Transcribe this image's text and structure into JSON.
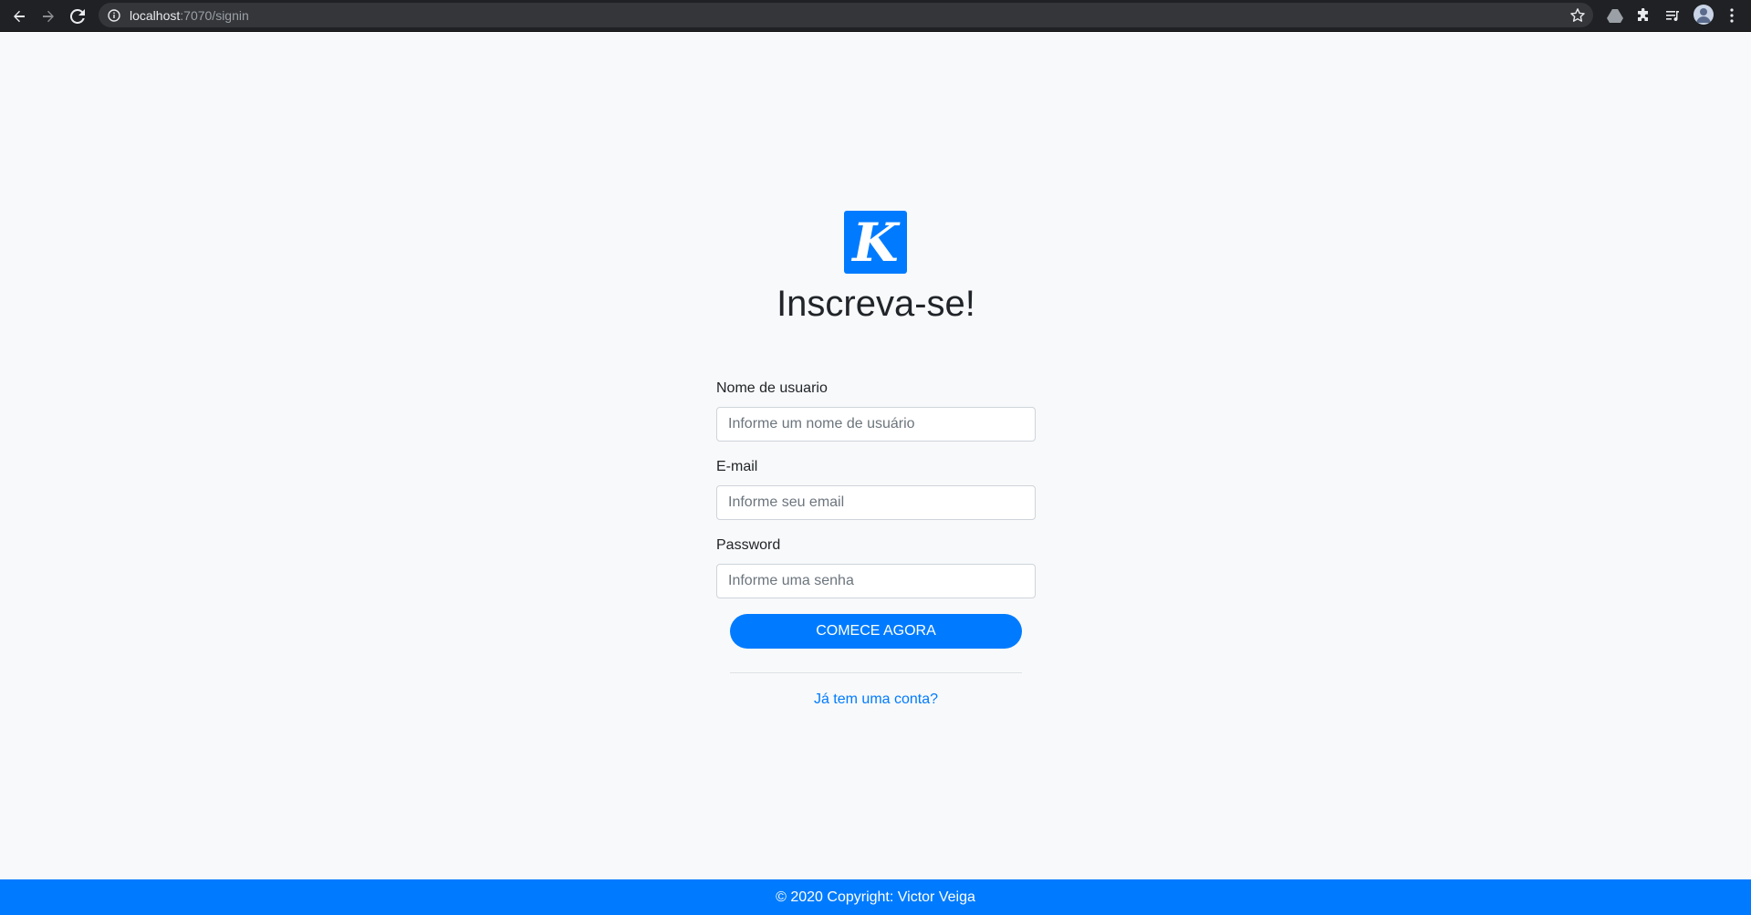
{
  "browser": {
    "url_host": "localhost",
    "url_path": ":7070/signin",
    "icons": {
      "back": "back-arrow-icon",
      "forward": "forward-arrow-icon",
      "reload": "reload-icon",
      "info": "info-icon",
      "star": "star-icon",
      "drive": "drive-icon",
      "extensions": "puzzle-icon",
      "media": "media-queue-icon",
      "profile": "avatar",
      "menu": "kebab-menu-icon"
    }
  },
  "logo": {
    "letter": "K",
    "color": "#007bff"
  },
  "page": {
    "title": "Inscreva-se!"
  },
  "form": {
    "username_label": "Nome de usuario",
    "username_placeholder": "Informe um nome de usuário",
    "email_label": "E-mail",
    "email_placeholder": "Informe seu email",
    "password_label": "Password",
    "password_placeholder": "Informe uma senha",
    "submit_label": "COMECE AGORA",
    "login_link": "Já tem uma conta?"
  },
  "footer": {
    "text": "© 2020 Copyright: Victor Veiga"
  },
  "colors": {
    "primary": "#007bff",
    "background": "#f8f9fa",
    "browser_chrome": "#202124"
  }
}
